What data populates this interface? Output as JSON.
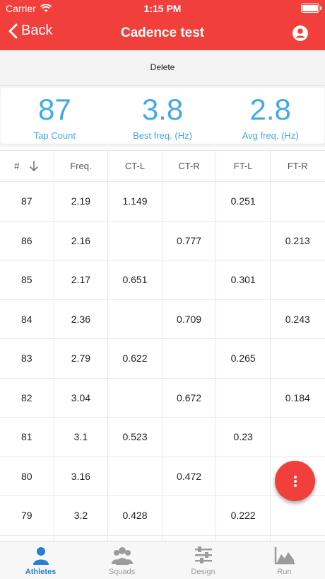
{
  "status_bar": {
    "carrier": "Carrier",
    "time": "1:15 PM"
  },
  "nav": {
    "back_label": "Back",
    "title": "Cadence test"
  },
  "toolbar": {
    "delete_label": "Delete"
  },
  "stats": [
    {
      "value": "87",
      "label": "Tap Count"
    },
    {
      "value": "3.8",
      "label": "Best freq. (Hz)"
    },
    {
      "value": "2.8",
      "label": "Avg freq. (Hz)"
    }
  ],
  "table": {
    "columns": [
      "#",
      "Freq.",
      "CT-L",
      "CT-R",
      "FT-L",
      "FT-R"
    ],
    "rows": [
      [
        "87",
        "2.19",
        "1.149",
        "",
        "0.251",
        ""
      ],
      [
        "86",
        "2.16",
        "",
        "0.777",
        "",
        "0.213"
      ],
      [
        "85",
        "2.17",
        "0.651",
        "",
        "0.301",
        ""
      ],
      [
        "84",
        "2.36",
        "",
        "0.709",
        "",
        "0.243"
      ],
      [
        "83",
        "2.79",
        "0.622",
        "",
        "0.265",
        ""
      ],
      [
        "82",
        "3.04",
        "",
        "0.672",
        "",
        "0.184"
      ],
      [
        "81",
        "3.1",
        "0.523",
        "",
        "0.23",
        ""
      ],
      [
        "80",
        "3.16",
        "",
        "0.472",
        "",
        ""
      ],
      [
        "79",
        "3.2",
        "0.428",
        "",
        "0.222",
        ""
      ],
      [
        "",
        "",
        "",
        "",
        "",
        ""
      ]
    ]
  },
  "tabs": [
    {
      "label": "Athletes",
      "icon": "person-icon",
      "active": true
    },
    {
      "label": "Squads",
      "icon": "group-icon",
      "active": false
    },
    {
      "label": "Design",
      "icon": "sliders-icon",
      "active": false
    },
    {
      "label": "Run",
      "icon": "area-chart-icon",
      "active": false
    }
  ],
  "colors": {
    "accent": "#f1403c",
    "stat_blue": "#43a9e7",
    "tab_active": "#2b7fd0"
  }
}
